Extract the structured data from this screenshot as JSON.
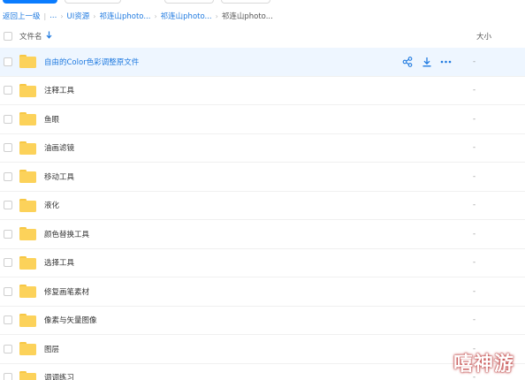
{
  "breadcrumb": {
    "items": [
      "返回上一级",
      "...",
      "UI资源",
      "祁连山photo...",
      "祁连山photo...",
      "祁连山photo..."
    ]
  },
  "header": {
    "name_label": "文件名",
    "sort_icon": "arrow-down-icon",
    "size_label": "大小"
  },
  "files": [
    {
      "name": "自由的Color色彩调整原文件",
      "size": "-"
    },
    {
      "name": "注释工具",
      "size": "-"
    },
    {
      "name": "鱼眼",
      "size": "-"
    },
    {
      "name": "油画滤镜",
      "size": "-"
    },
    {
      "name": "移动工具",
      "size": "-"
    },
    {
      "name": "液化",
      "size": "-"
    },
    {
      "name": "颜色替换工具",
      "size": "-"
    },
    {
      "name": "选择工具",
      "size": "-"
    },
    {
      "name": "修复画笔素材",
      "size": "-"
    },
    {
      "name": "像素与矢量图像",
      "size": "-"
    },
    {
      "name": "图层",
      "size": "-"
    },
    {
      "name": "调调练习",
      "size": "-"
    }
  ],
  "row_actions": [
    "share-icon",
    "download-icon",
    "more-icon"
  ],
  "colors": {
    "accent": "#1f7ae0",
    "folder": "#fcd25a",
    "hover_row": "#eef6ff"
  },
  "watermark": "嘻神游"
}
